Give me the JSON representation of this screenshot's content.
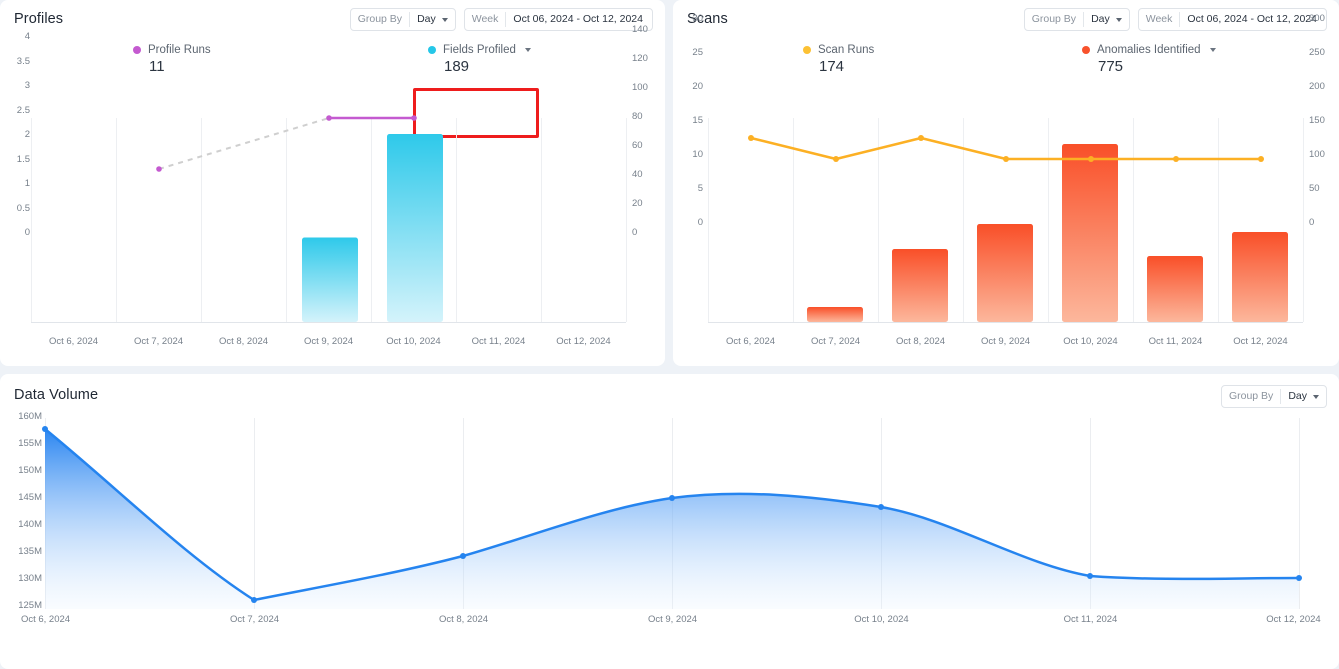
{
  "panels": {
    "profiles": {
      "title": "Profiles",
      "group_by": {
        "label": "Group By",
        "value": "Day"
      },
      "range": {
        "label": "Week",
        "value": "Oct 06, 2024 - Oct 12, 2024"
      },
      "kpis": [
        {
          "name": "Profile Runs",
          "value": "11",
          "color": "#c45ad0",
          "has_caret": false
        },
        {
          "name": "Fields Profiled",
          "value": "189",
          "color": "#25c7e8",
          "has_caret": true
        }
      ],
      "highlight_color": "#ee1d1d"
    },
    "scans": {
      "title": "Scans",
      "group_by": {
        "label": "Group By",
        "value": "Day"
      },
      "range": {
        "label": "Week",
        "value": "Oct 06, 2024 - Oct 12, 2024"
      },
      "kpis": [
        {
          "name": "Scan Runs",
          "value": "174",
          "color": "#fcc134",
          "has_caret": false
        },
        {
          "name": "Anomalies Identified",
          "value": "775",
          "color": "#f8522c",
          "has_caret": true
        }
      ]
    },
    "volume": {
      "title": "Data Volume",
      "group_by": {
        "label": "Group By",
        "value": "Day"
      }
    }
  },
  "chart_data": [
    {
      "id": "profiles-chart",
      "type": "bar",
      "title": "Profiles",
      "xlabel": "",
      "ylabel": "",
      "grid": true,
      "legend_position": "top",
      "categories": [
        "Oct 6, 2024",
        "Oct 7, 2024",
        "Oct 8, 2024",
        "Oct 9, 2024",
        "Oct 10, 2024",
        "Oct 11, 2024",
        "Oct 12, 2024"
      ],
      "left_axis": {
        "name": "Profile Runs",
        "ylim": [
          0,
          4
        ],
        "ticks": [
          "0",
          "0.5",
          "1",
          "1.5",
          "2",
          "2.5",
          "3",
          "3.5",
          "4"
        ],
        "tick_values": [
          0,
          0.5,
          1,
          1.5,
          2,
          2.5,
          3,
          3.5,
          4
        ]
      },
      "right_axis": {
        "name": "Fields Profiled",
        "ylim": [
          0,
          140
        ],
        "ticks": [
          "0",
          "20",
          "40",
          "60",
          "80",
          "100",
          "120",
          "140"
        ],
        "tick_values": [
          0,
          20,
          40,
          60,
          80,
          100,
          120,
          140
        ]
      },
      "series": [
        {
          "name": "Fields Profiled",
          "type": "bar",
          "axis": "right",
          "color": "#25c7e8",
          "values": [
            null,
            null,
            null,
            58,
            129,
            null,
            null
          ]
        },
        {
          "name": "Profile Runs",
          "type": "line",
          "axis": "left",
          "color": "#c45ad0",
          "dashed_gap": true,
          "values": [
            null,
            3,
            null,
            4,
            4,
            null,
            null
          ]
        }
      ]
    },
    {
      "id": "scans-chart",
      "type": "bar",
      "title": "Scans",
      "xlabel": "",
      "ylabel": "",
      "grid": true,
      "legend_position": "top",
      "categories": [
        "Oct 6, 2024",
        "Oct 7, 2024",
        "Oct 8, 2024",
        "Oct 9, 2024",
        "Oct 10, 2024",
        "Oct 11, 2024",
        "Oct 12, 2024"
      ],
      "left_axis": {
        "name": "Scan Runs",
        "ylim": [
          0,
          30
        ],
        "ticks": [
          "0",
          "5",
          "10",
          "15",
          "20",
          "25",
          "30"
        ],
        "tick_values": [
          0,
          5,
          10,
          15,
          20,
          25,
          30
        ]
      },
      "right_axis": {
        "name": "Anomalies Identified",
        "ylim": [
          0,
          300
        ],
        "ticks": [
          "0",
          "50",
          "100",
          "150",
          "200",
          "250",
          "300"
        ],
        "tick_values": [
          0,
          50,
          100,
          150,
          200,
          250,
          300
        ]
      },
      "series": [
        {
          "name": "Anomalies Identified",
          "type": "bar",
          "axis": "right",
          "color": "#f8522c",
          "values": [
            0,
            22,
            107,
            144,
            262,
            97,
            133
          ]
        },
        {
          "name": "Scan Runs",
          "type": "line",
          "axis": "left",
          "color": "#fcb024",
          "values": [
            27,
            24,
            27,
            24,
            24,
            24,
            24
          ]
        }
      ]
    },
    {
      "id": "volume-chart",
      "type": "area",
      "title": "Data Volume",
      "xlabel": "",
      "ylabel": "",
      "grid": true,
      "legend_position": "none",
      "categories": [
        "Oct 6, 2024",
        "Oct 7, 2024",
        "Oct 8, 2024",
        "Oct 9, 2024",
        "Oct 10, 2024",
        "Oct 11, 2024",
        "Oct 12, 2024"
      ],
      "left_axis": {
        "ylim": [
          125000000,
          160000000
        ],
        "ticks": [
          "125M",
          "130M",
          "135M",
          "140M",
          "145M",
          "150M",
          "155M",
          "160M"
        ],
        "tick_values": [
          125000000,
          130000000,
          135000000,
          140000000,
          145000000,
          150000000,
          155000000,
          160000000
        ]
      },
      "series": [
        {
          "name": "Data Volume",
          "type": "area",
          "color": "#2584ef",
          "values": [
            158400000,
            126500000,
            134800000,
            145600000,
            143900000,
            131000000,
            130600000
          ]
        }
      ]
    }
  ]
}
